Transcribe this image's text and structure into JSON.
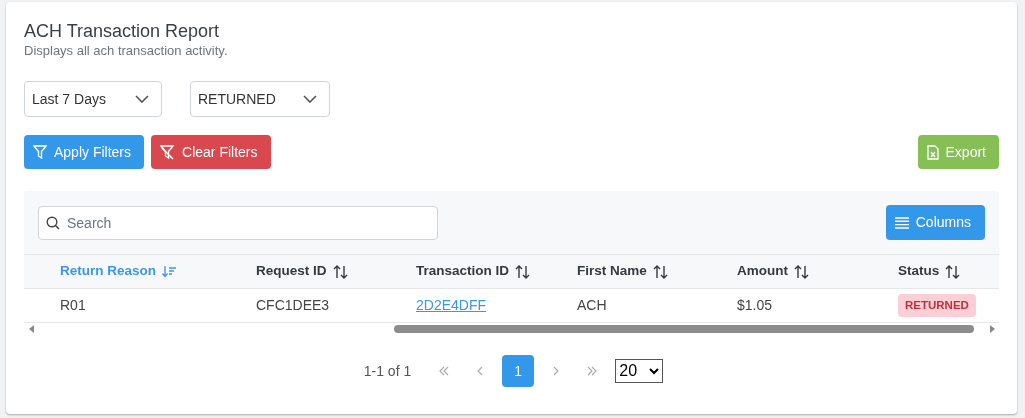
{
  "header": {
    "title": "ACH Transaction Report",
    "subtitle": "Displays all ach transaction activity."
  },
  "filters": [
    {
      "value": "Last 7 Days"
    },
    {
      "value": "RETURNED"
    }
  ],
  "buttons": [
    {
      "kind": "apply",
      "label": "Apply Filters"
    },
    {
      "kind": "clear",
      "label": "Clear Filters"
    },
    {
      "kind": "export",
      "label": "Export"
    }
  ],
  "table": {
    "search": {
      "placeholder": "Search"
    },
    "columns_button": "Columns",
    "columns": [
      {
        "label": "Return Reason",
        "sorted": true
      },
      {
        "label": "Request ID",
        "sorted": false
      },
      {
        "label": "Transaction ID",
        "sorted": false
      },
      {
        "label": "First Name",
        "sorted": false
      },
      {
        "label": "Amount",
        "sorted": false
      },
      {
        "label": "Status",
        "sorted": false
      }
    ],
    "rows": [
      {
        "cells": [
          "R01",
          "CFC1DEE3",
          "2D2E4DFF",
          "ACH",
          "$1.05",
          "RETURNED"
        ]
      }
    ]
  },
  "pagination": {
    "summary": "1-1 of 1",
    "pages": [
      {
        "label": "1",
        "selected": true
      }
    ],
    "per_page": "20"
  }
}
